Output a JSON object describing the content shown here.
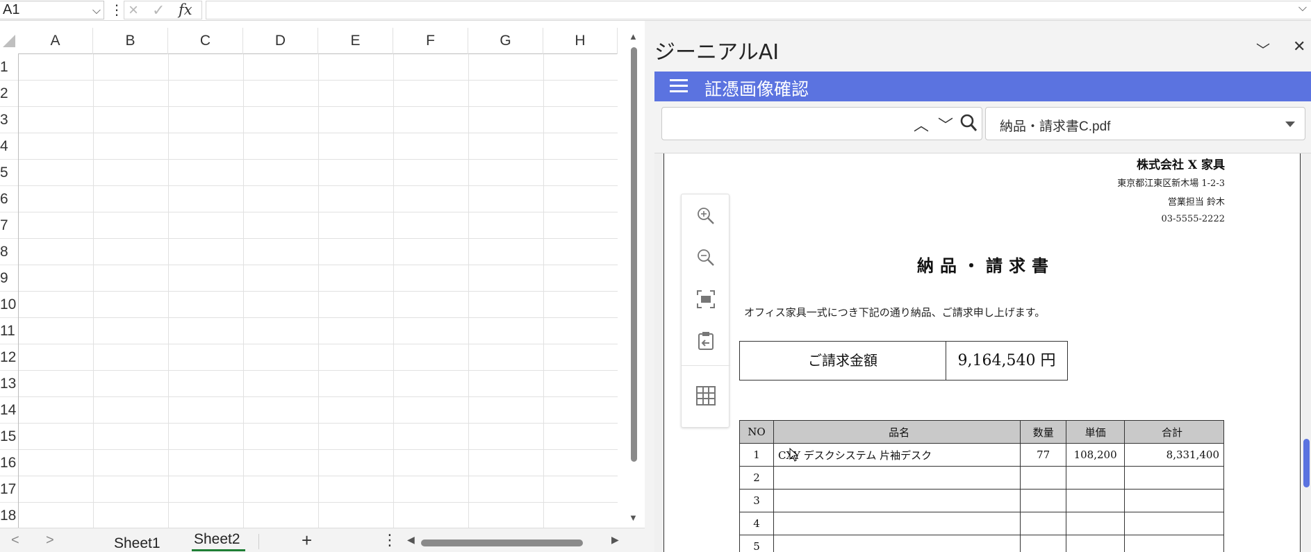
{
  "formula_bar": {
    "name_box": "A1",
    "formula": ""
  },
  "grid": {
    "columns": [
      "A",
      "B",
      "C",
      "D",
      "E",
      "F",
      "G",
      "H"
    ],
    "rows": [
      "1",
      "2",
      "3",
      "4",
      "5",
      "6",
      "7",
      "8",
      "9",
      "10",
      "11",
      "12",
      "13",
      "14",
      "15",
      "16",
      "17",
      "18"
    ]
  },
  "sheets": {
    "tabs": [
      "Sheet1",
      "Sheet2"
    ],
    "active": "Sheet2",
    "add_label": "+"
  },
  "side_panel": {
    "title": "ジーニアルAI",
    "header_title": "証憑画像確認",
    "search_value": "",
    "file_selected": "納品・請求書C.pdf",
    "document": {
      "company": "株式会社 X 家具",
      "address": "東京都江東区新木場 1-2-3",
      "representative": "営業担当 鈴木",
      "phone": "03-5555-2222",
      "title": "納品・請求書",
      "intro": "オフィス家具一式につき下記の通り納品、ご請求申し上げます。",
      "amount_label": "ご請求金額",
      "amount_value": "9,164,540 円",
      "table_headers": [
        "NO",
        "品名",
        "数量",
        "単価",
        "合計"
      ],
      "rows": [
        {
          "no": "1",
          "name": "CXY デスクシステム 片袖デスク",
          "qty": "77",
          "price": "108,200",
          "total": "8,331,400"
        },
        {
          "no": "2",
          "name": "",
          "qty": "",
          "price": "",
          "total": ""
        },
        {
          "no": "3",
          "name": "",
          "qty": "",
          "price": "",
          "total": ""
        },
        {
          "no": "4",
          "name": "",
          "qty": "",
          "price": "",
          "total": ""
        },
        {
          "no": "5",
          "name": "",
          "qty": "",
          "price": "",
          "total": ""
        }
      ]
    },
    "toolbar_icons": [
      "zoom-in-icon",
      "zoom-out-icon",
      "fit-page-icon",
      "paste-back-icon",
      "table-grid-icon"
    ]
  },
  "colors": {
    "accent_blue": "#5b73e0",
    "active_sheet_underline": "#1e7e34",
    "table_header_gray": "#c9c9c9"
  }
}
